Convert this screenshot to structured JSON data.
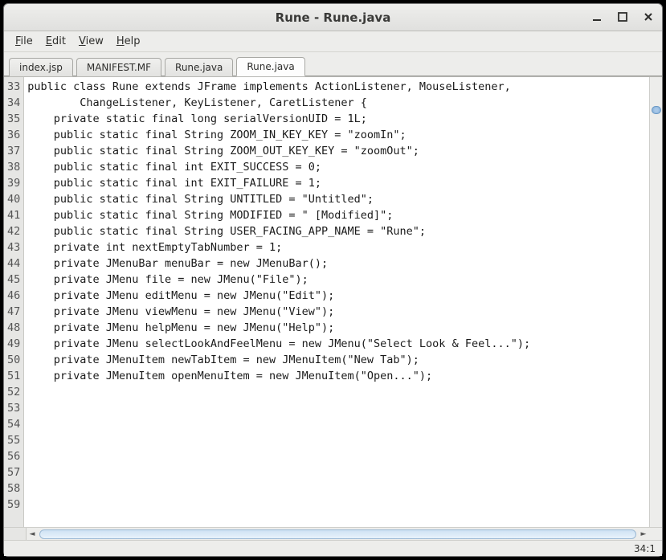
{
  "window": {
    "title": "Rune - Rune.java"
  },
  "menubar": {
    "items": [
      {
        "label": "File",
        "accel": "F"
      },
      {
        "label": "Edit",
        "accel": "E"
      },
      {
        "label": "View",
        "accel": "V"
      },
      {
        "label": "Help",
        "accel": "H"
      }
    ]
  },
  "tabs": [
    {
      "label": "index.jsp",
      "active": false
    },
    {
      "label": "MANIFEST.MF",
      "active": false
    },
    {
      "label": "Rune.java",
      "active": false
    },
    {
      "label": "Rune.java",
      "active": true
    }
  ],
  "editor": {
    "first_line": 33,
    "lines": [
      "public class Rune extends JFrame implements ActionListener, MouseListener,",
      "        ChangeListener, KeyListener, CaretListener {",
      "",
      "    private static final long serialVersionUID = 1L;",
      "",
      "    public static final String ZOOM_IN_KEY_KEY = \"zoomIn\";",
      "    public static final String ZOOM_OUT_KEY_KEY = \"zoomOut\";",
      "",
      "    public static final int EXIT_SUCCESS = 0;",
      "    public static final int EXIT_FAILURE = 1;",
      "",
      "    public static final String UNTITLED = \"Untitled\";",
      "    public static final String MODIFIED = \" [Modified]\";",
      "    public static final String USER_FACING_APP_NAME = \"Rune\";",
      "",
      "    private int nextEmptyTabNumber = 1;",
      "",
      "    private JMenuBar menuBar = new JMenuBar();",
      "    private JMenu file = new JMenu(\"File\");",
      "    private JMenu editMenu = new JMenu(\"Edit\");",
      "    private JMenu viewMenu = new JMenu(\"View\");",
      "    private JMenu helpMenu = new JMenu(\"Help\");",
      "",
      "    private JMenu selectLookAndFeelMenu = new JMenu(\"Select Look & Feel...\");",
      "",
      "    private JMenuItem newTabItem = new JMenuItem(\"New Tab\");",
      "    private JMenuItem openMenuItem = new JMenuItem(\"Open...\");"
    ]
  },
  "status": {
    "cursor": "34:1"
  }
}
